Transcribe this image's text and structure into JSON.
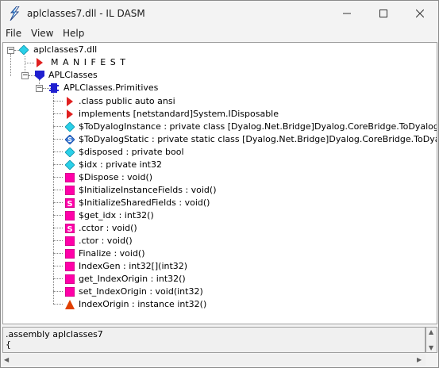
{
  "window": {
    "title": "aplclasses7.dll - IL DASM"
  },
  "menu": {
    "file": "File",
    "view": "View",
    "help": "Help"
  },
  "tree": {
    "root": "aplclasses7.dll",
    "manifest": "M A N I F E S T",
    "namespace": "APLClasses",
    "class": "APLClasses.Primitives",
    "members": [
      {
        "label": ".class public auto ansi",
        "icon": "red-triangle-right"
      },
      {
        "label": "implements [netstandard]System.IDisposable",
        "icon": "red-triangle-right"
      },
      {
        "label": "$ToDyalogInstance : private class [Dyalog.Net.Bridge]Dyalog.CoreBridge.ToDyalog",
        "icon": "field-diamond-cyan"
      },
      {
        "label": "$ToDyalogStatic : private static class [Dyalog.Net.Bridge]Dyalog.CoreBridge.ToDyalog",
        "icon": "static-field-diamond"
      },
      {
        "label": "$disposed : private bool",
        "icon": "field-diamond-cyan"
      },
      {
        "label": "$idx : private int32",
        "icon": "field-diamond-cyan"
      },
      {
        "label": "$Dispose : void()",
        "icon": "method-square-magenta"
      },
      {
        "label": "$InitializeInstanceFields : void()",
        "icon": "method-square-magenta"
      },
      {
        "label": "$InitializeSharedFields : void()",
        "icon": "static-method-square"
      },
      {
        "label": "$get_idx : int32()",
        "icon": "method-square-magenta"
      },
      {
        "label": ".cctor : void()",
        "icon": "static-method-square"
      },
      {
        "label": ".ctor : void()",
        "icon": "method-square-magenta"
      },
      {
        "label": "Finalize : void()",
        "icon": "method-square-magenta"
      },
      {
        "label": "IndexGen : int32[](int32)",
        "icon": "method-square-magenta"
      },
      {
        "label": "get_IndexOrigin : int32()",
        "icon": "method-square-magenta"
      },
      {
        "label": "set_IndexOrigin : void(int32)",
        "icon": "method-square-magenta"
      },
      {
        "label": "IndexOrigin : instance int32()",
        "icon": "property-triangle-red"
      }
    ]
  },
  "info": {
    "line1": ".assembly aplclasses7",
    "line2": "{"
  },
  "colors": {
    "field": "#2ad0e8",
    "method": "#ff00a8",
    "arrow": "#e02020",
    "namespace": "#2020d0",
    "property": "#e04000"
  }
}
